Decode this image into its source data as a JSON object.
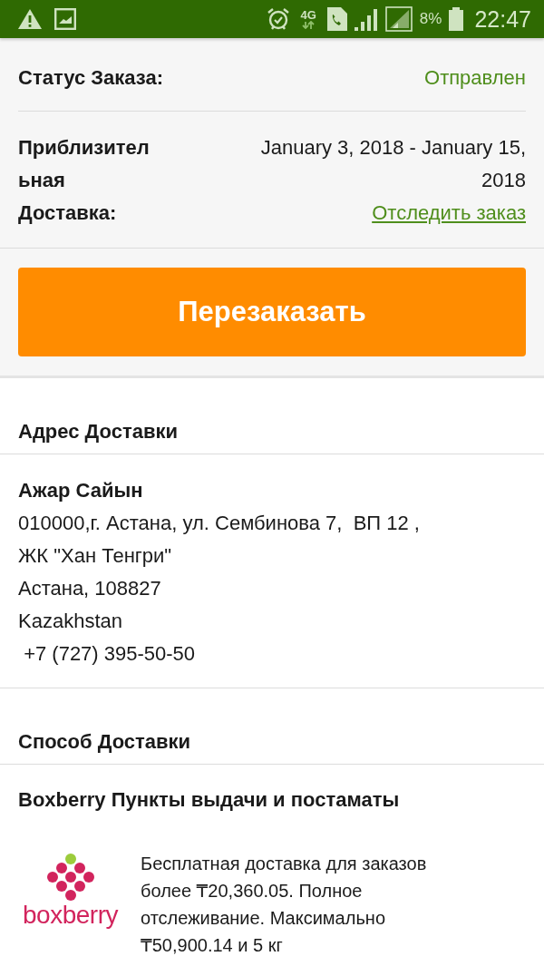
{
  "status_bar": {
    "network": "4G",
    "battery": "8%",
    "time": "22:47"
  },
  "order_summary": {
    "status": {
      "label": "Статус Заказа:",
      "value": "Отправлен"
    },
    "delivery": {
      "label": "Приблизительная Доставка:",
      "value": "January 3, 2018 - January 15, 2018",
      "link": "Отследить заказ"
    },
    "reorder_button": "Перезаказать"
  },
  "shipping_address": {
    "title": "Адрес Доставки",
    "name": "Ажар Сайын",
    "lines": [
      "010000,г. Астана, ул. Сембинова 7,  ВП 12 ,",
      "ЖК \"Хан Тенгри\"",
      "Астана, 108827",
      "Kazakhstan",
      " +7 (727) 395-50-50"
    ]
  },
  "shipping_method": {
    "title": "Способ Доставки",
    "carrier": "Boxberry Пункты выдачи и постаматы",
    "logo_text": "boxberry",
    "description": "Бесплатная доставка для заказов более ₸20,360.05. Полное отслеживание. Максимально ₸50,900.14 и 5 кг"
  }
}
